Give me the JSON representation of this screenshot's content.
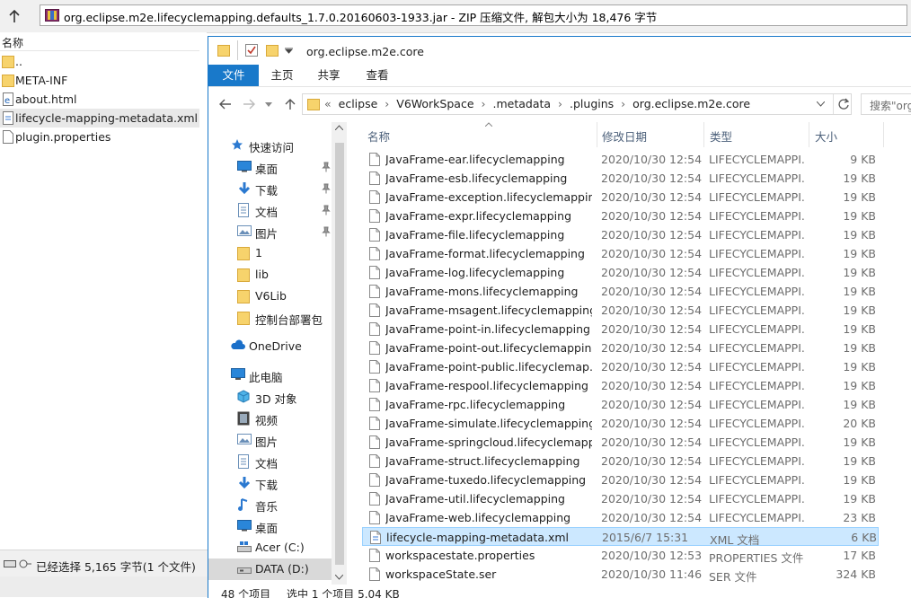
{
  "rar": {
    "path_text": "org.eclipse.m2e.lifecyclemapping.defaults_1.7.0.20160603-1933.jar - ZIP 压缩文件, 解包大小为 18,476 字节",
    "column_name": "名称",
    "items": [
      {
        "label": "..",
        "icon": "folder-icon"
      },
      {
        "label": "META-INF",
        "icon": "folder-icon"
      },
      {
        "label": "about.html",
        "icon": "html-file-icon"
      },
      {
        "label": "lifecycle-mapping-metadata.xml",
        "icon": "xml-file-icon"
      },
      {
        "label": "plugin.properties",
        "icon": "file-icon"
      }
    ],
    "status": "已经选择 5,165 字节(1 个文件)"
  },
  "explorer": {
    "title": "org.eclipse.m2e.core",
    "ribbon_tabs": [
      "文件",
      "主页",
      "共享",
      "查看"
    ],
    "breadcrumb": [
      "«",
      "eclipse",
      "›",
      "V6WorkSpace",
      "›",
      ".metadata",
      "›",
      ".plugins",
      "›",
      "org.eclipse.m2e.core"
    ],
    "search_placeholder": "搜索\"org",
    "nav": [
      {
        "label": "快速访问",
        "icon": "star-icon",
        "pinned": false
      },
      {
        "label": "桌面",
        "icon": "desktop-icon",
        "pinned": true
      },
      {
        "label": "下载",
        "icon": "download-icon",
        "pinned": true
      },
      {
        "label": "文档",
        "icon": "document-icon",
        "pinned": true
      },
      {
        "label": "图片",
        "icon": "pictures-icon",
        "pinned": true
      },
      {
        "label": "1",
        "icon": "folder-icon",
        "pinned": false
      },
      {
        "label": "lib",
        "icon": "folder-icon",
        "pinned": false
      },
      {
        "label": "V6Lib",
        "icon": "folder-icon",
        "pinned": false
      },
      {
        "label": "控制台部署包",
        "icon": "folder-icon",
        "pinned": false
      },
      {
        "label": "OneDrive",
        "icon": "cloud-icon",
        "pinned": false
      },
      {
        "label": "此电脑",
        "icon": "computer-icon",
        "pinned": false
      },
      {
        "label": "3D 对象",
        "icon": "cube-icon",
        "pinned": false
      },
      {
        "label": "视频",
        "icon": "video-icon",
        "pinned": false
      },
      {
        "label": "图片",
        "icon": "pictures-icon",
        "pinned": false
      },
      {
        "label": "文档",
        "icon": "document-icon",
        "pinned": false
      },
      {
        "label": "下载",
        "icon": "download-icon",
        "pinned": false
      },
      {
        "label": "音乐",
        "icon": "music-icon",
        "pinned": false
      },
      {
        "label": "桌面",
        "icon": "desktop-icon",
        "pinned": false
      },
      {
        "label": "Acer (C:)",
        "icon": "drive-icon",
        "pinned": false
      },
      {
        "label": "DATA (D:)",
        "icon": "drive-icon",
        "pinned": false
      }
    ],
    "columns": [
      "名称",
      "修改日期",
      "类型",
      "大小"
    ],
    "files": [
      {
        "name": "JavaFrame-ear.lifecyclemapping",
        "date": "2020/10/30 12:54",
        "type": "LIFECYCLEMAPPI...",
        "size": "9 KB"
      },
      {
        "name": "JavaFrame-esb.lifecyclemapping",
        "date": "2020/10/30 12:54",
        "type": "LIFECYCLEMAPPI...",
        "size": "19 KB"
      },
      {
        "name": "JavaFrame-exception.lifecyclemapping",
        "date": "2020/10/30 12:54",
        "type": "LIFECYCLEMAPPI...",
        "size": "19 KB"
      },
      {
        "name": "JavaFrame-expr.lifecyclemapping",
        "date": "2020/10/30 12:54",
        "type": "LIFECYCLEMAPPI...",
        "size": "19 KB"
      },
      {
        "name": "JavaFrame-file.lifecyclemapping",
        "date": "2020/10/30 12:54",
        "type": "LIFECYCLEMAPPI...",
        "size": "19 KB"
      },
      {
        "name": "JavaFrame-format.lifecyclemapping",
        "date": "2020/10/30 12:54",
        "type": "LIFECYCLEMAPPI...",
        "size": "19 KB"
      },
      {
        "name": "JavaFrame-log.lifecyclemapping",
        "date": "2020/10/30 12:54",
        "type": "LIFECYCLEMAPPI...",
        "size": "19 KB"
      },
      {
        "name": "JavaFrame-mons.lifecyclemapping",
        "date": "2020/10/30 12:54",
        "type": "LIFECYCLEMAPPI...",
        "size": "19 KB"
      },
      {
        "name": "JavaFrame-msagent.lifecyclemapping",
        "date": "2020/10/30 12:54",
        "type": "LIFECYCLEMAPPI...",
        "size": "19 KB"
      },
      {
        "name": "JavaFrame-point-in.lifecyclemapping",
        "date": "2020/10/30 12:54",
        "type": "LIFECYCLEMAPPI...",
        "size": "19 KB"
      },
      {
        "name": "JavaFrame-point-out.lifecyclemapping",
        "date": "2020/10/30 12:54",
        "type": "LIFECYCLEMAPPI...",
        "size": "19 KB"
      },
      {
        "name": "JavaFrame-point-public.lifecyclemap...",
        "date": "2020/10/30 12:54",
        "type": "LIFECYCLEMAPPI...",
        "size": "19 KB"
      },
      {
        "name": "JavaFrame-respool.lifecyclemapping",
        "date": "2020/10/30 12:54",
        "type": "LIFECYCLEMAPPI...",
        "size": "19 KB"
      },
      {
        "name": "JavaFrame-rpc.lifecyclemapping",
        "date": "2020/10/30 12:54",
        "type": "LIFECYCLEMAPPI...",
        "size": "19 KB"
      },
      {
        "name": "JavaFrame-simulate.lifecyclemapping",
        "date": "2020/10/30 12:54",
        "type": "LIFECYCLEMAPPI...",
        "size": "20 KB"
      },
      {
        "name": "JavaFrame-springcloud.lifecyclemapp",
        "date": "2020/10/30 12:54",
        "type": "LIFECYCLEMAPPI...",
        "size": "19 KB"
      },
      {
        "name": "JavaFrame-struct.lifecyclemapping",
        "date": "2020/10/30 12:54",
        "type": "LIFECYCLEMAPPI...",
        "size": "19 KB"
      },
      {
        "name": "JavaFrame-tuxedo.lifecyclemapping",
        "date": "2020/10/30 12:54",
        "type": "LIFECYCLEMAPPI...",
        "size": "19 KB"
      },
      {
        "name": "JavaFrame-util.lifecyclemapping",
        "date": "2020/10/30 12:54",
        "type": "LIFECYCLEMAPPI...",
        "size": "19 KB"
      },
      {
        "name": "JavaFrame-web.lifecyclemapping",
        "date": "2020/10/30 12:54",
        "type": "LIFECYCLEMAPPI...",
        "size": "23 KB"
      },
      {
        "name": "lifecycle-mapping-metadata.xml",
        "date": "2015/6/7 15:31",
        "type": "XML 文档",
        "size": "6 KB",
        "selected": true
      },
      {
        "name": "workspacestate.properties",
        "date": "2020/10/30 12:53",
        "type": "PROPERTIES 文件",
        "size": "17 KB"
      },
      {
        "name": "workspaceState.ser",
        "date": "2020/10/30 11:46",
        "type": "SER 文件",
        "size": "324 KB"
      }
    ],
    "status": {
      "count": "48 个项目",
      "selection": "选中 1 个项目  5.04 KB"
    }
  },
  "colors": {
    "accent": "#1979ca",
    "folder": "#f7d36c",
    "selected_row": "#cce8ff"
  }
}
